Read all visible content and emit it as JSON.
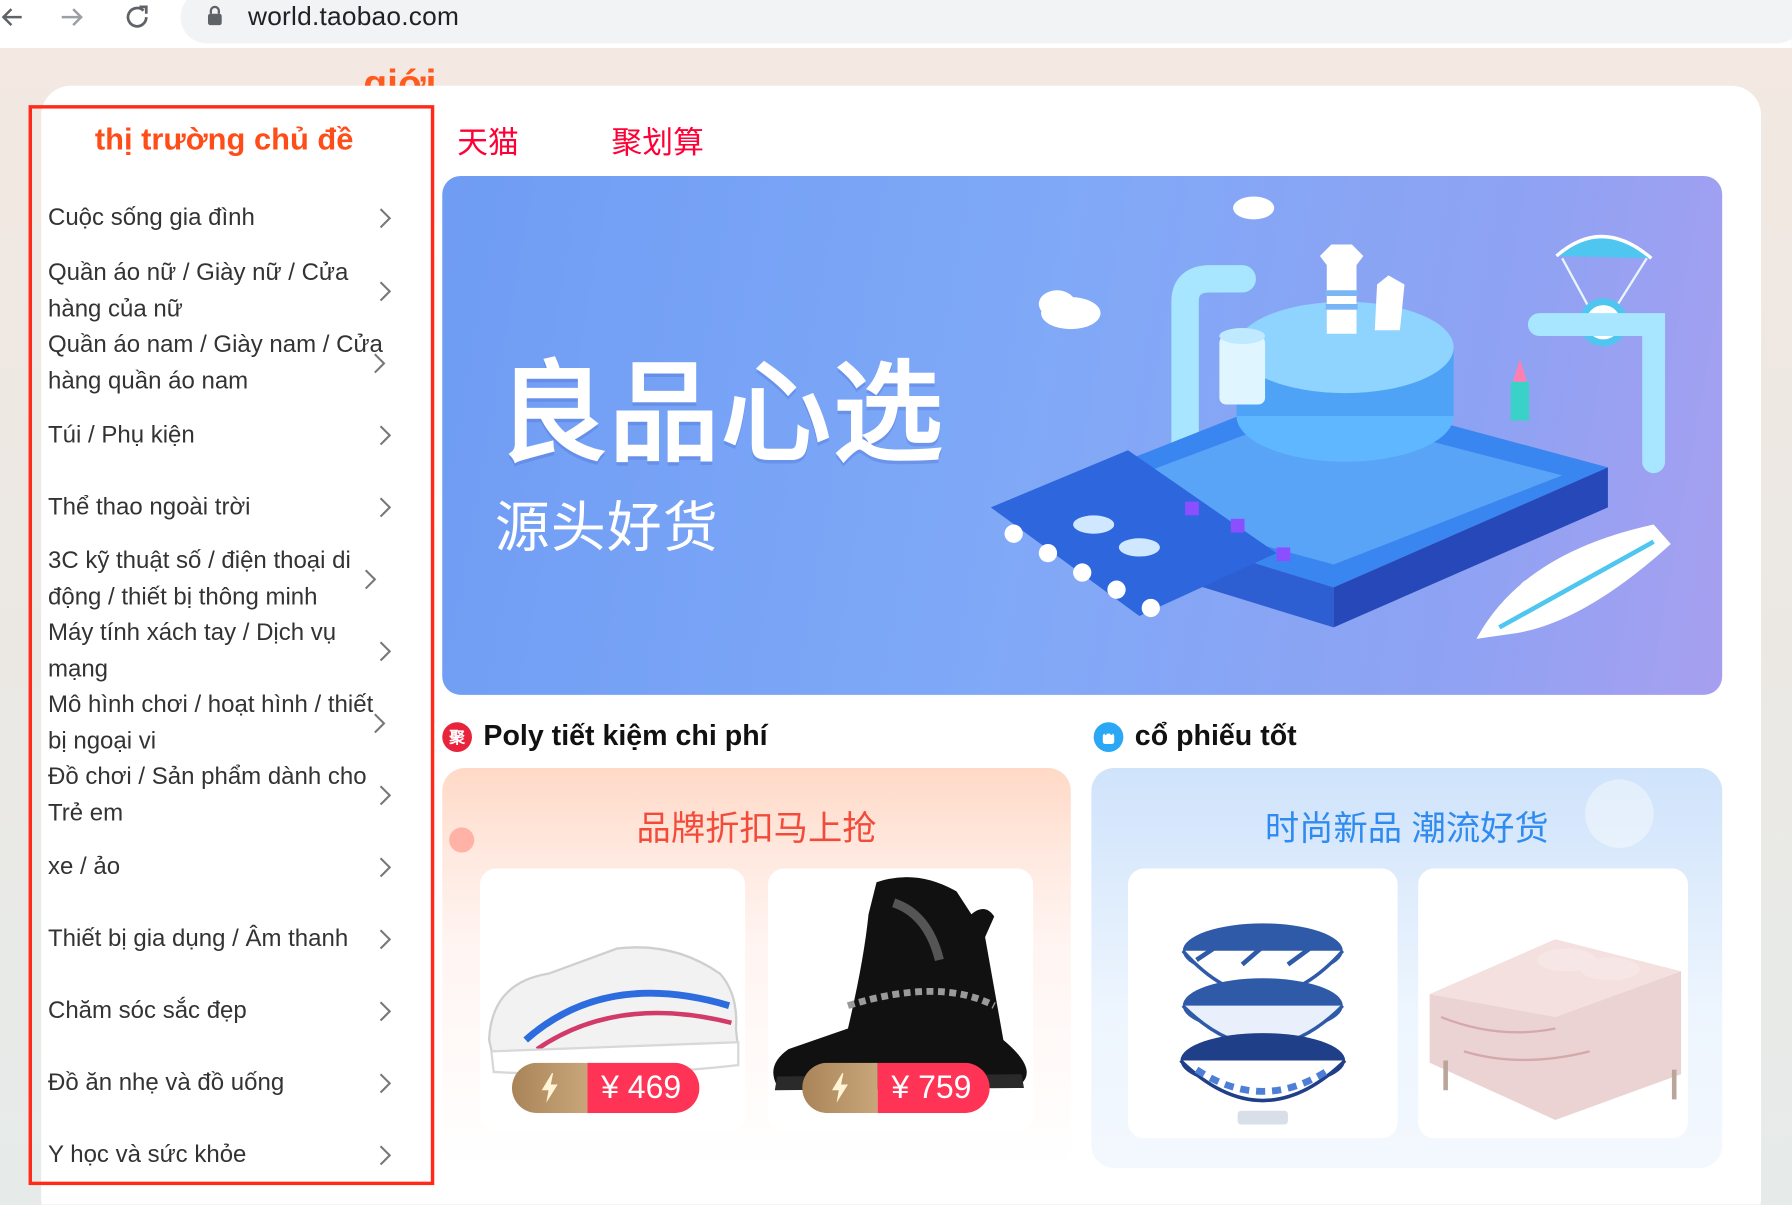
{
  "browser": {
    "url": "world.taobao.com"
  },
  "page": {
    "cut_heading": "giới"
  },
  "sidebar": {
    "title": "thị trường chủ đề",
    "items": [
      {
        "label": "Cuộc sống gia đình"
      },
      {
        "label": "Quần áo nữ / Giày nữ / Cửa hàng của nữ"
      },
      {
        "label": "Quần áo nam / Giày nam / Cửa hàng quần áo nam"
      },
      {
        "label": "Túi / Phụ kiện"
      },
      {
        "label": "Thể thao ngoài trời"
      },
      {
        "label": "3C kỹ thuật số / điện thoại di động / thiết bị thông minh"
      },
      {
        "label": "Máy tính xách tay / Dịch vụ mạng"
      },
      {
        "label": "Mô hình chơi / hoạt hình / thiết bị ngoại vi"
      },
      {
        "label": "Đồ chơi / Sản phẩm dành cho Trẻ em"
      },
      {
        "label": "xe / ảo"
      },
      {
        "label": "Thiết bị gia dụng / Âm thanh"
      },
      {
        "label": "Chăm sóc sắc đẹp"
      },
      {
        "label": "Đồ ăn nhẹ và đồ uống"
      },
      {
        "label": "Y học và sức khỏe"
      }
    ]
  },
  "tabs": [
    {
      "label": "天猫"
    },
    {
      "label": "聚划算"
    }
  ],
  "banner": {
    "title": "良品心选",
    "subtitle": "源头好货"
  },
  "sections": [
    {
      "icon_text": "聚",
      "title": "Poly tiết kiệm chi phí",
      "promo_title": "品牌折扣马上抢",
      "products": [
        {
          "price": "¥ 469"
        },
        {
          "price": "¥ 759"
        }
      ]
    },
    {
      "icon_text": "",
      "title": "cổ phiếu tốt",
      "promo_title": "时尚新品 潮流好货"
    }
  ],
  "colors": {
    "accent_red": "#ff0036",
    "sidebar_border": "#ff2a1a",
    "title_orange": "#ff4d19",
    "price_red": "#ff3355"
  }
}
